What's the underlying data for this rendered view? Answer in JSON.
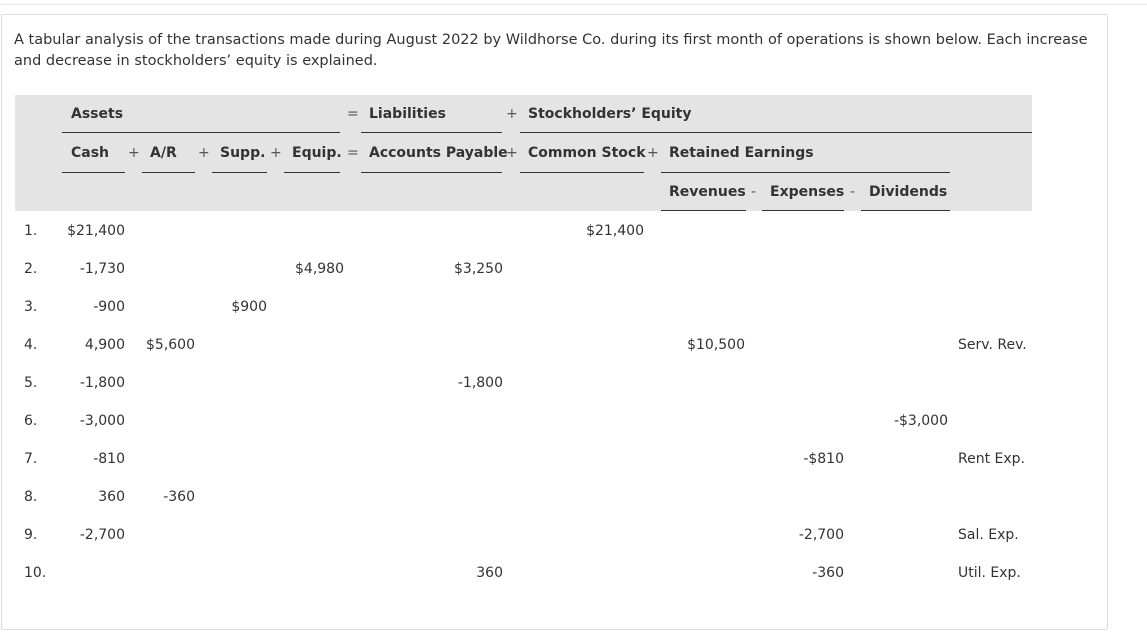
{
  "intro": "A tabular analysis of the transactions made during August 2022 by Wildhorse Co. during its first month of operations is shown below. Each increase and decrease in stockholders’ equity is explained.",
  "header": {
    "assets": "Assets",
    "eq1": "=",
    "liabilities": "Liabilities",
    "plus1": "+",
    "equity": "Stockholders’ Equity",
    "cash": "Cash",
    "p_ar": "+",
    "ar": "A/R",
    "p_supp": "+",
    "supp": "Supp.",
    "p_equip": "+",
    "equip": "Equip.",
    "eq2": "=",
    "ap": "Accounts Payable",
    "p_cs": "+",
    "cs": "Common Stock",
    "p_re": "+",
    "re": "Retained Earnings",
    "revenues": "Revenues",
    "m_exp": "-",
    "expenses": "Expenses",
    "m_div": "-",
    "dividends": "Dividends"
  },
  "rows": [
    {
      "n": "1.",
      "cash": "$21,400",
      "ar": "",
      "supp": "",
      "equip": "",
      "ap": "",
      "cs": "$21,400",
      "rev": "",
      "exp": "",
      "div": "",
      "expl": ""
    },
    {
      "n": "2.",
      "cash": "-1,730",
      "ar": "",
      "supp": "",
      "equip": "$4,980",
      "ap": "$3,250",
      "cs": "",
      "rev": "",
      "exp": "",
      "div": "",
      "expl": ""
    },
    {
      "n": "3.",
      "cash": "-900",
      "ar": "",
      "supp": "$900",
      "equip": "",
      "ap": "",
      "cs": "",
      "rev": "",
      "exp": "",
      "div": "",
      "expl": ""
    },
    {
      "n": "4.",
      "cash": "4,900",
      "ar": "$5,600",
      "supp": "",
      "equip": "",
      "ap": "",
      "cs": "",
      "rev": "$10,500",
      "exp": "",
      "div": "",
      "expl": "Serv. Rev."
    },
    {
      "n": "5.",
      "cash": "-1,800",
      "ar": "",
      "supp": "",
      "equip": "",
      "ap": "-1,800",
      "cs": "",
      "rev": "",
      "exp": "",
      "div": "",
      "expl": ""
    },
    {
      "n": "6.",
      "cash": "-3,000",
      "ar": "",
      "supp": "",
      "equip": "",
      "ap": "",
      "cs": "",
      "rev": "",
      "exp": "",
      "div": "-$3,000",
      "expl": ""
    },
    {
      "n": "7.",
      "cash": "-810",
      "ar": "",
      "supp": "",
      "equip": "",
      "ap": "",
      "cs": "",
      "rev": "",
      "exp": "-$810",
      "div": "",
      "expl": "Rent Exp."
    },
    {
      "n": "8.",
      "cash": "360",
      "ar": "-360",
      "supp": "",
      "equip": "",
      "ap": "",
      "cs": "",
      "rev": "",
      "exp": "",
      "div": "",
      "expl": ""
    },
    {
      "n": "9.",
      "cash": "-2,700",
      "ar": "",
      "supp": "",
      "equip": "",
      "ap": "",
      "cs": "",
      "rev": "",
      "exp": "-2,700",
      "div": "",
      "expl": "Sal. Exp."
    },
    {
      "n": "10.",
      "cash": "",
      "ar": "",
      "supp": "",
      "equip": "",
      "ap": "360",
      "cs": "",
      "rev": "",
      "exp": "-360",
      "div": "",
      "expl": "Util. Exp."
    }
  ]
}
